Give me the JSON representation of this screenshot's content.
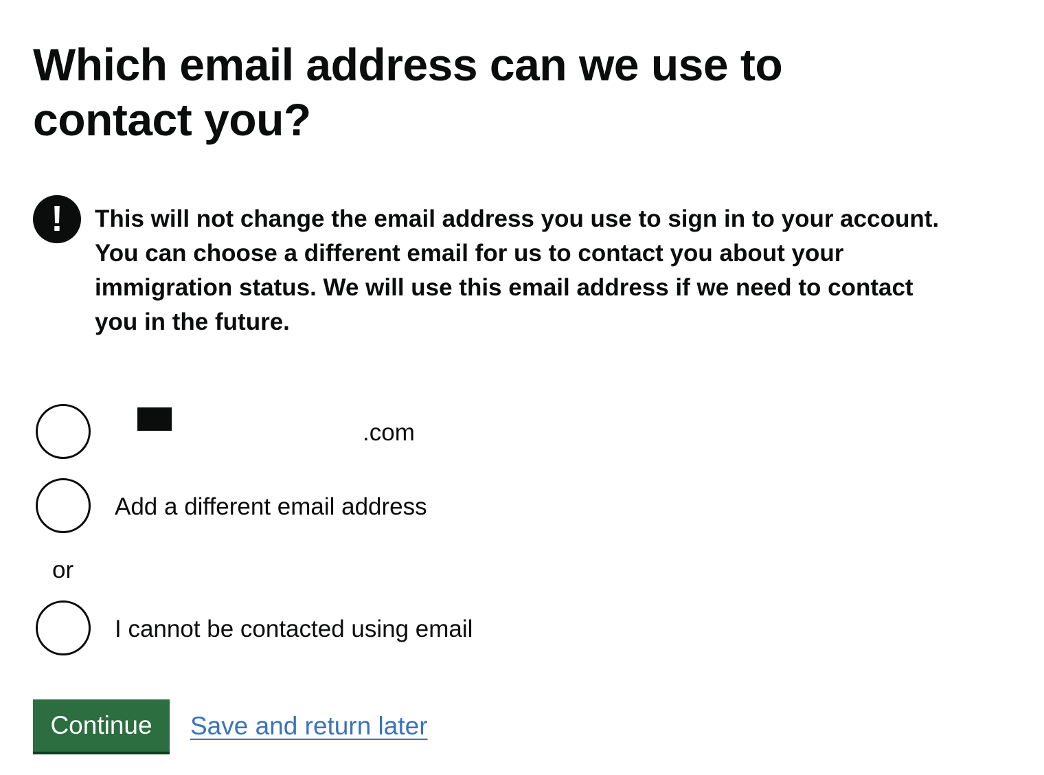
{
  "heading": "Which email address can we use to contact you?",
  "warning": {
    "icon": "exclamation-icon",
    "icon_glyph": "!",
    "text": "This will not change the email address you use to sign in to your account. You can choose a different email for us to contact you about your immigration status. We will use this email address if we need to contact you in the future."
  },
  "options": [
    {
      "label": ".com",
      "selected": false
    },
    {
      "label": "Add a different email address",
      "selected": false
    },
    {
      "label": "I cannot be contacted using email",
      "selected": false
    }
  ],
  "divider_text": "or",
  "actions": {
    "continue_label": "Continue",
    "save_link_label": "Save and return later"
  },
  "colors": {
    "text": "#0b0c0c",
    "button": "#2c6e3f",
    "button_shadow": "#0f3d20",
    "link": "#3a73b8"
  }
}
